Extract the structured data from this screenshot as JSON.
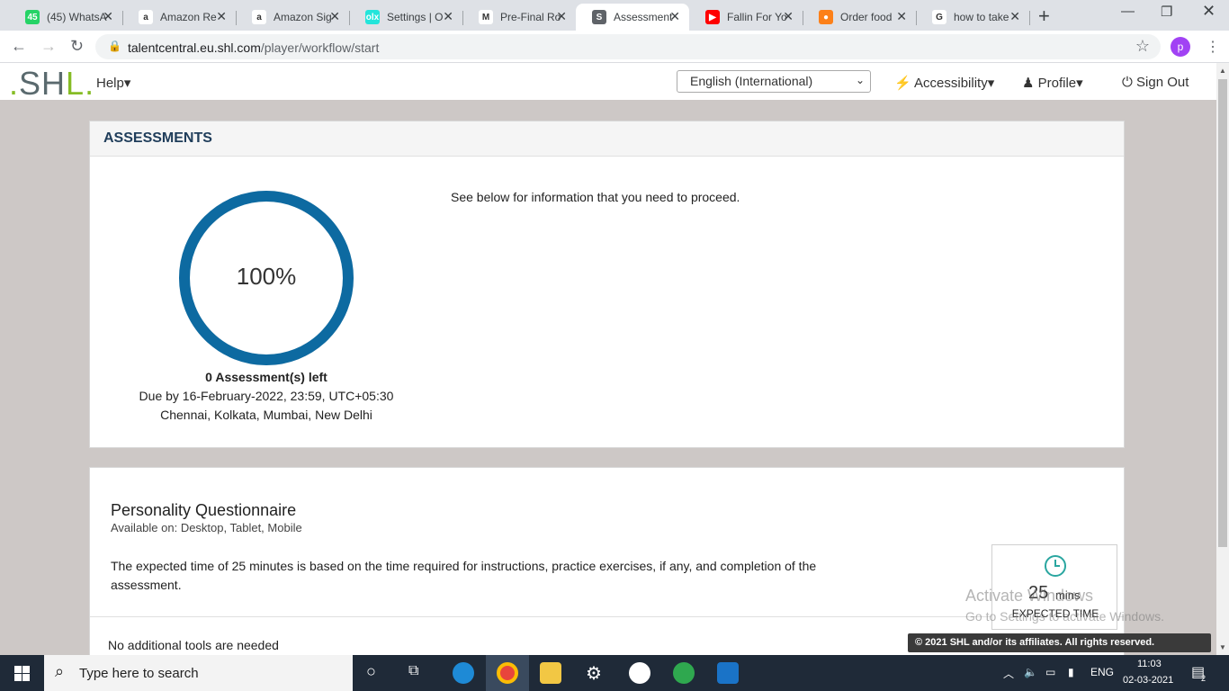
{
  "browser": {
    "tabs": [
      {
        "title": "(45) WhatsA",
        "fav": "45",
        "color": "#25d366"
      },
      {
        "title": "Amazon Re",
        "fav": "a",
        "color": "#ffffff"
      },
      {
        "title": "Amazon Sig",
        "fav": "a",
        "color": "#ffffff"
      },
      {
        "title": "Settings | O",
        "fav": "olx",
        "color": "#23e5db"
      },
      {
        "title": "Pre-Final Ro",
        "fav": "M",
        "color": "#ffffff"
      },
      {
        "title": "Assessment",
        "fav": "S",
        "color": "#5f6368"
      },
      {
        "title": "Fallin For Yo",
        "fav": "▶",
        "color": "#ff0000"
      },
      {
        "title": "Order food",
        "fav": "●",
        "color": "#fc8019"
      },
      {
        "title": "how to take",
        "fav": "G",
        "color": "#ffffff"
      }
    ],
    "url_host": "talentcentral.eu.shl.com",
    "url_path": "/player/workflow/start",
    "profile_initial": "p"
  },
  "app": {
    "logo": ".SHL.",
    "help": "Help▾",
    "language": "English (International)",
    "accessibility": "Accessibility▾",
    "profile": "Profile▾",
    "signout": "Sign Out"
  },
  "assessments": {
    "header": "ASSESSMENTS",
    "progress_text": "100%",
    "progress_value": 100,
    "left": "0 Assessment(s) left",
    "due": "Due by 16-February-2022, 23:59, UTC+05:30",
    "tz": "Chennai, Kolkata, Mumbai, New Delhi",
    "info": "See below for information that you need to proceed."
  },
  "questionnaire": {
    "title": "Personality Questionnaire",
    "available": "Available on:  Desktop, Tablet, Mobile",
    "description": "The expected time of 25 minutes is based on the time required for instructions, practice exercises, if any, and completion of the assessment.",
    "time_value": "25",
    "time_unit": "mins",
    "time_label": "EXPECTED TIME",
    "tools": "No additional tools are needed"
  },
  "overlay": {
    "watermark_title": "Activate Windows",
    "watermark_sub": "Go to Settings to activate Windows.",
    "copyright": "© 2021 SHL and/or its affiliates. All rights reserved."
  },
  "taskbar": {
    "search_placeholder": "Type here to search",
    "lang": "ENG",
    "time": "11:03",
    "date": "02-03-2021",
    "notifications": "2"
  }
}
